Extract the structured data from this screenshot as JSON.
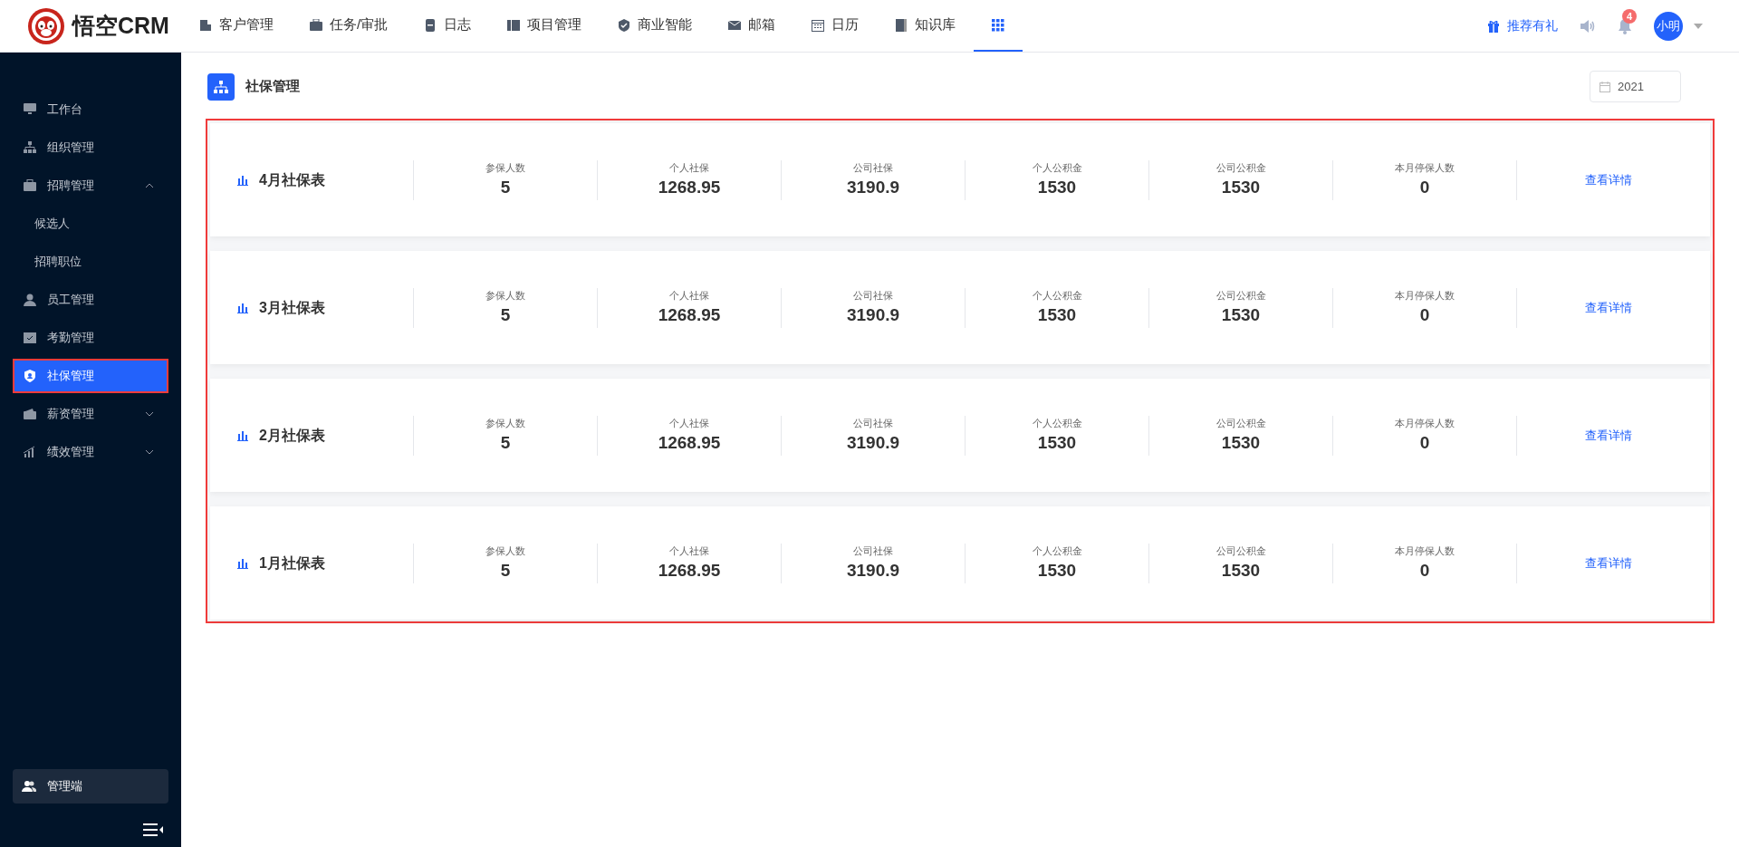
{
  "logo": {
    "text": "悟空CRM"
  },
  "nav": [
    {
      "label": "客户管理",
      "selected": false
    },
    {
      "label": "任务/审批",
      "selected": false
    },
    {
      "label": "日志",
      "selected": false
    },
    {
      "label": "项目管理",
      "selected": false
    },
    {
      "label": "商业智能",
      "selected": false
    },
    {
      "label": "邮箱",
      "selected": false
    },
    {
      "label": "日历",
      "selected": false
    },
    {
      "label": "知识库",
      "selected": false
    },
    {
      "kind": "apps",
      "selected": true
    }
  ],
  "header_right": {
    "referral": "推荐有礼",
    "notifications": "4",
    "avatar": "小明"
  },
  "sidebar": {
    "items": [
      {
        "label": "工作台",
        "selected": false
      },
      {
        "label": "组织管理",
        "selected": false
      },
      {
        "label": "招聘管理",
        "selected": false,
        "expanded": true,
        "children": [
          {
            "label": "候选人",
            "selected": false
          },
          {
            "label": "招聘职位",
            "selected": false
          }
        ]
      },
      {
        "label": "员工管理",
        "selected": false
      },
      {
        "label": "考勤管理",
        "selected": false
      },
      {
        "label": "社保管理",
        "selected": true
      },
      {
        "label": "薪资管理",
        "selected": false,
        "expanded": false
      },
      {
        "label": "绩效管理",
        "selected": false,
        "expanded": false
      }
    ],
    "admin": "管理端"
  },
  "page": {
    "title": "社保管理",
    "year": "2021"
  },
  "cards": [
    {
      "title": "4月社保表",
      "stats": [
        {
          "label": "参保人数",
          "value": "5"
        },
        {
          "label": "个人社保",
          "value": "1268.95"
        },
        {
          "label": "公司社保",
          "value": "3190.9"
        },
        {
          "label": "个人公积金",
          "value": "1530"
        },
        {
          "label": "公司公积金",
          "value": "1530"
        },
        {
          "label": "本月停保人数",
          "value": "0"
        }
      ],
      "link": "查看详情"
    },
    {
      "title": "3月社保表",
      "stats": [
        {
          "label": "参保人数",
          "value": "5"
        },
        {
          "label": "个人社保",
          "value": "1268.95"
        },
        {
          "label": "公司社保",
          "value": "3190.9"
        },
        {
          "label": "个人公积金",
          "value": "1530"
        },
        {
          "label": "公司公积金",
          "value": "1530"
        },
        {
          "label": "本月停保人数",
          "value": "0"
        }
      ],
      "link": "查看详情"
    },
    {
      "title": "2月社保表",
      "stats": [
        {
          "label": "参保人数",
          "value": "5"
        },
        {
          "label": "个人社保",
          "value": "1268.95"
        },
        {
          "label": "公司社保",
          "value": "3190.9"
        },
        {
          "label": "个人公积金",
          "value": "1530"
        },
        {
          "label": "公司公积金",
          "value": "1530"
        },
        {
          "label": "本月停保人数",
          "value": "0"
        }
      ],
      "link": "查看详情"
    },
    {
      "title": "1月社保表",
      "stats": [
        {
          "label": "参保人数",
          "value": "5"
        },
        {
          "label": "个人社保",
          "value": "1268.95"
        },
        {
          "label": "公司社保",
          "value": "3190.9"
        },
        {
          "label": "个人公积金",
          "value": "1530"
        },
        {
          "label": "公司公积金",
          "value": "1530"
        },
        {
          "label": "本月停保人数",
          "value": "0"
        }
      ],
      "link": "查看详情"
    }
  ]
}
